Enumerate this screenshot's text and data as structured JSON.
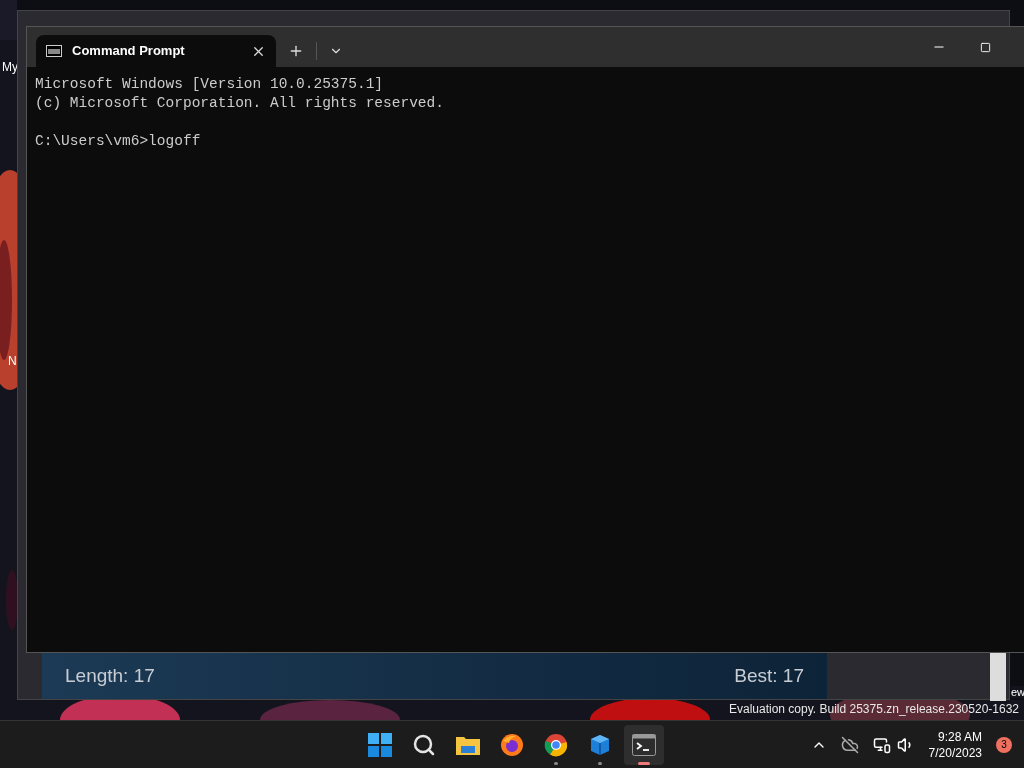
{
  "desktop": {
    "icon_labels": [
      "My",
      "N"
    ],
    "edge_label": "ew",
    "watermark": "Evaluation copy. Build 25375.zn_release.230520-1632"
  },
  "background_window": {
    "game_status": {
      "length": "Length: 17",
      "best": "Best: 17"
    }
  },
  "terminal": {
    "tabs": [
      {
        "title": "Command Prompt",
        "selected": true
      }
    ],
    "blocks": [
      [
        "Microsoft Windows [Version 10.0.25375.1]",
        "(c) Microsoft Corporation. All rights reserved."
      ],
      [
        "C:\\Users\\vm6>logoff"
      ]
    ]
  },
  "taskbar": {
    "apps": [
      {
        "kind": "start",
        "active": false
      },
      {
        "kind": "search",
        "active": false
      },
      {
        "kind": "folder",
        "active": false
      },
      {
        "kind": "firefox",
        "active": false
      },
      {
        "kind": "chrome",
        "active": false,
        "running": true
      },
      {
        "kind": "cube",
        "active": false,
        "running": true
      },
      {
        "kind": "terminal",
        "active": true,
        "running": true
      }
    ],
    "time": "9:28 AM",
    "date": "7/20/2023",
    "notifications": "3"
  }
}
